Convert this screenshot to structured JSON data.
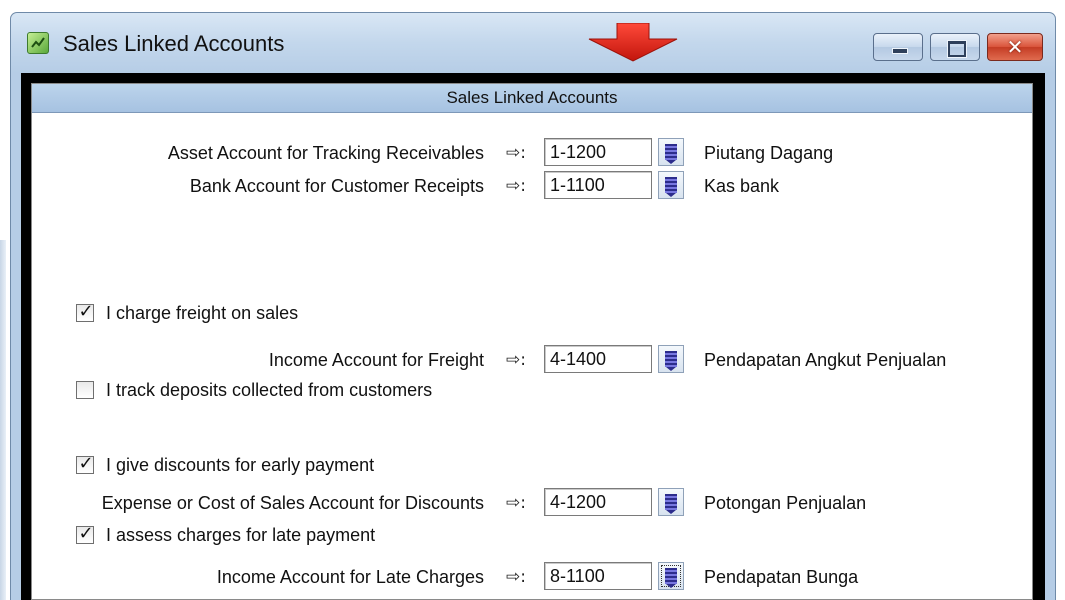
{
  "window": {
    "title": "Sales Linked Accounts",
    "accent_arrow_color": "#e0231b",
    "buttons": {
      "minimize": "minimize-icon",
      "maximize": "maximize-icon",
      "close": "close-icon"
    }
  },
  "panel": {
    "header": "Sales Linked Accounts",
    "arrow_symbol": "⇨:",
    "rows": {
      "receivables": {
        "label": "Asset Account for Tracking Receivables",
        "account": "1-1200",
        "name": "Piutang Dagang"
      },
      "bank": {
        "label": "Bank Account for Customer Receipts",
        "account": "1-1100",
        "name": "Kas bank"
      },
      "freight": {
        "label": "Income Account for Freight",
        "account": "4-1400",
        "name": "Pendapatan Angkut Penjualan"
      },
      "discounts": {
        "label": "Expense or Cost of Sales Account for Discounts",
        "account": "4-1200",
        "name": "Potongan Penjualan"
      },
      "late": {
        "label": "Income Account for Late Charges",
        "account": "8-1100",
        "name": "Pendapatan Bunga"
      }
    },
    "checkboxes": {
      "freight": {
        "label": "I charge freight on sales",
        "checked": true
      },
      "deposits": {
        "label": "I track deposits collected from customers",
        "checked": false
      },
      "discounts": {
        "label": "I give discounts for early payment",
        "checked": true
      },
      "late": {
        "label": "I assess charges for late payment",
        "checked": true
      }
    },
    "check_mark": "✓"
  }
}
